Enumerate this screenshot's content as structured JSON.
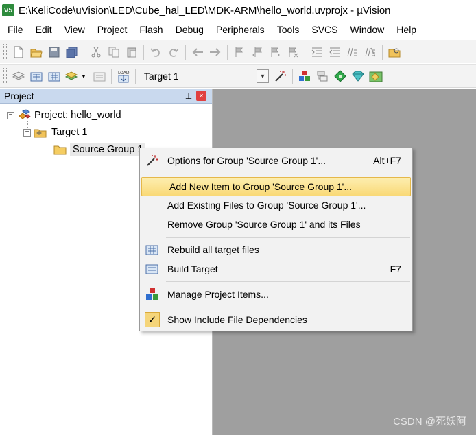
{
  "window": {
    "title": "E:\\KeliCode\\uVision\\LED\\Cube_hal_LED\\MDK-ARM\\hello_world.uvprojx - µVision",
    "app_icon_text": "V5"
  },
  "menubar": {
    "items": [
      "File",
      "Edit",
      "View",
      "Project",
      "Flash",
      "Debug",
      "Peripherals",
      "Tools",
      "SVCS",
      "Window",
      "Help"
    ]
  },
  "toolbar2": {
    "target_select": "Target 1"
  },
  "project_panel": {
    "title": "Project",
    "pin_glyph": "⊥",
    "close_glyph": "×",
    "tree": {
      "project": "Project: hello_world",
      "target": "Target 1",
      "group": "Source Group 1"
    }
  },
  "context_menu": {
    "items": [
      {
        "label": "Options for Group 'Source Group 1'...",
        "shortcut": "Alt+F7",
        "icon": "options-wand-icon"
      },
      {
        "label": "Add New  Item to Group 'Source Group 1'...",
        "shortcut": "",
        "icon": "",
        "highlighted": true
      },
      {
        "label": "Add Existing Files to Group 'Source Group 1'...",
        "shortcut": "",
        "icon": ""
      },
      {
        "label": "Remove Group 'Source Group 1' and its Files",
        "shortcut": "",
        "icon": ""
      },
      {
        "label": "Rebuild all target files",
        "shortcut": "",
        "icon": "rebuild-icon"
      },
      {
        "label": "Build Target",
        "shortcut": "F7",
        "icon": "build-icon"
      },
      {
        "label": "Manage Project Items...",
        "shortcut": "",
        "icon": "manage-items-icon"
      },
      {
        "label": "Show Include File Dependencies",
        "shortcut": "",
        "icon": "check-icon",
        "checked": true
      }
    ]
  },
  "watermark": "CSDN @死妖阿",
  "colors": {
    "panel_header": "#c9d9ee",
    "workspace": "#9f9f9f",
    "highlight": "#f9d977",
    "close": "#e04040"
  }
}
